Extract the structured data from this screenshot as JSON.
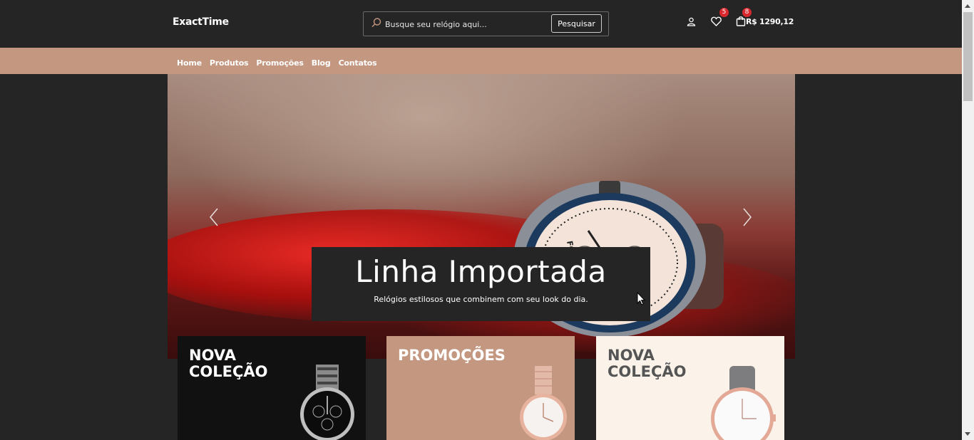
{
  "header": {
    "logo": "ExactTime",
    "search": {
      "placeholder": "Busque seu relógio aqui...",
      "button_label": "Pesquisar"
    },
    "wishlist_count": "5",
    "cart_count": "8",
    "cart_total": "R$ 1290,12"
  },
  "nav": {
    "items": [
      {
        "label": "Home"
      },
      {
        "label": "Produtos"
      },
      {
        "label": "Promoções"
      },
      {
        "label": "Blog"
      },
      {
        "label": "Contatos"
      }
    ]
  },
  "hero": {
    "title": "Linha Importada",
    "subtitle": "Relógios estilosos que combinem com seu look do dia.",
    "watch_brand": "FOSSIL"
  },
  "cards": [
    {
      "title": "NOVA COLEÇÃO"
    },
    {
      "title": "PROMOÇÕES"
    },
    {
      "title": "NOVA COLEÇÃO"
    }
  ],
  "colors": {
    "background": "#252525",
    "accent": "#c39780",
    "badge": "#d8282d",
    "card_light": "#fbf3ea"
  },
  "icons": [
    "search-icon",
    "user-icon",
    "heart-icon",
    "shopping-bag-icon",
    "chevron-left-icon",
    "chevron-right-icon",
    "mouse-cursor-icon"
  ]
}
